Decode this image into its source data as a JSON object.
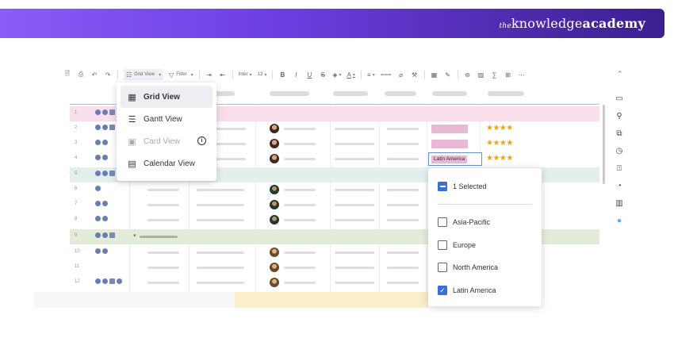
{
  "brand": {
    "prefix": "the",
    "name_regular": "knowledge",
    "name_bold": "academy"
  },
  "toolbar": {
    "view_label": "Grid View",
    "filter_label": "Filter",
    "font_label": "Inter",
    "size_label": "13"
  },
  "view_menu": {
    "items": [
      {
        "label": "Grid View",
        "icon": "grid-icon",
        "state": "active"
      },
      {
        "label": "Gantt View",
        "icon": "gantt-icon",
        "state": "normal"
      },
      {
        "label": "Card View",
        "icon": "card-icon",
        "state": "disabled"
      },
      {
        "label": "Calendar View",
        "icon": "calendar-icon",
        "state": "normal"
      }
    ]
  },
  "grid": {
    "row_numbers": [
      "1",
      "2",
      "3",
      "4",
      "5",
      "6",
      "7",
      "8",
      "9",
      "10",
      "11",
      "12"
    ],
    "active_tag": "Latin America",
    "rating": "★★★★"
  },
  "region_menu": {
    "summary": "1 Selected",
    "options": [
      {
        "label": "Asia-Pacific",
        "checked": false
      },
      {
        "label": "Europe",
        "checked": false
      },
      {
        "label": "North America",
        "checked": false
      },
      {
        "label": "Latin America",
        "checked": true
      }
    ]
  },
  "colors": {
    "accent": "#3a6fd8",
    "banner_start": "#8a5cf6",
    "banner_end": "#3b1f8f",
    "star": "#e8a515",
    "tag_pink": "#e9b8d4"
  }
}
